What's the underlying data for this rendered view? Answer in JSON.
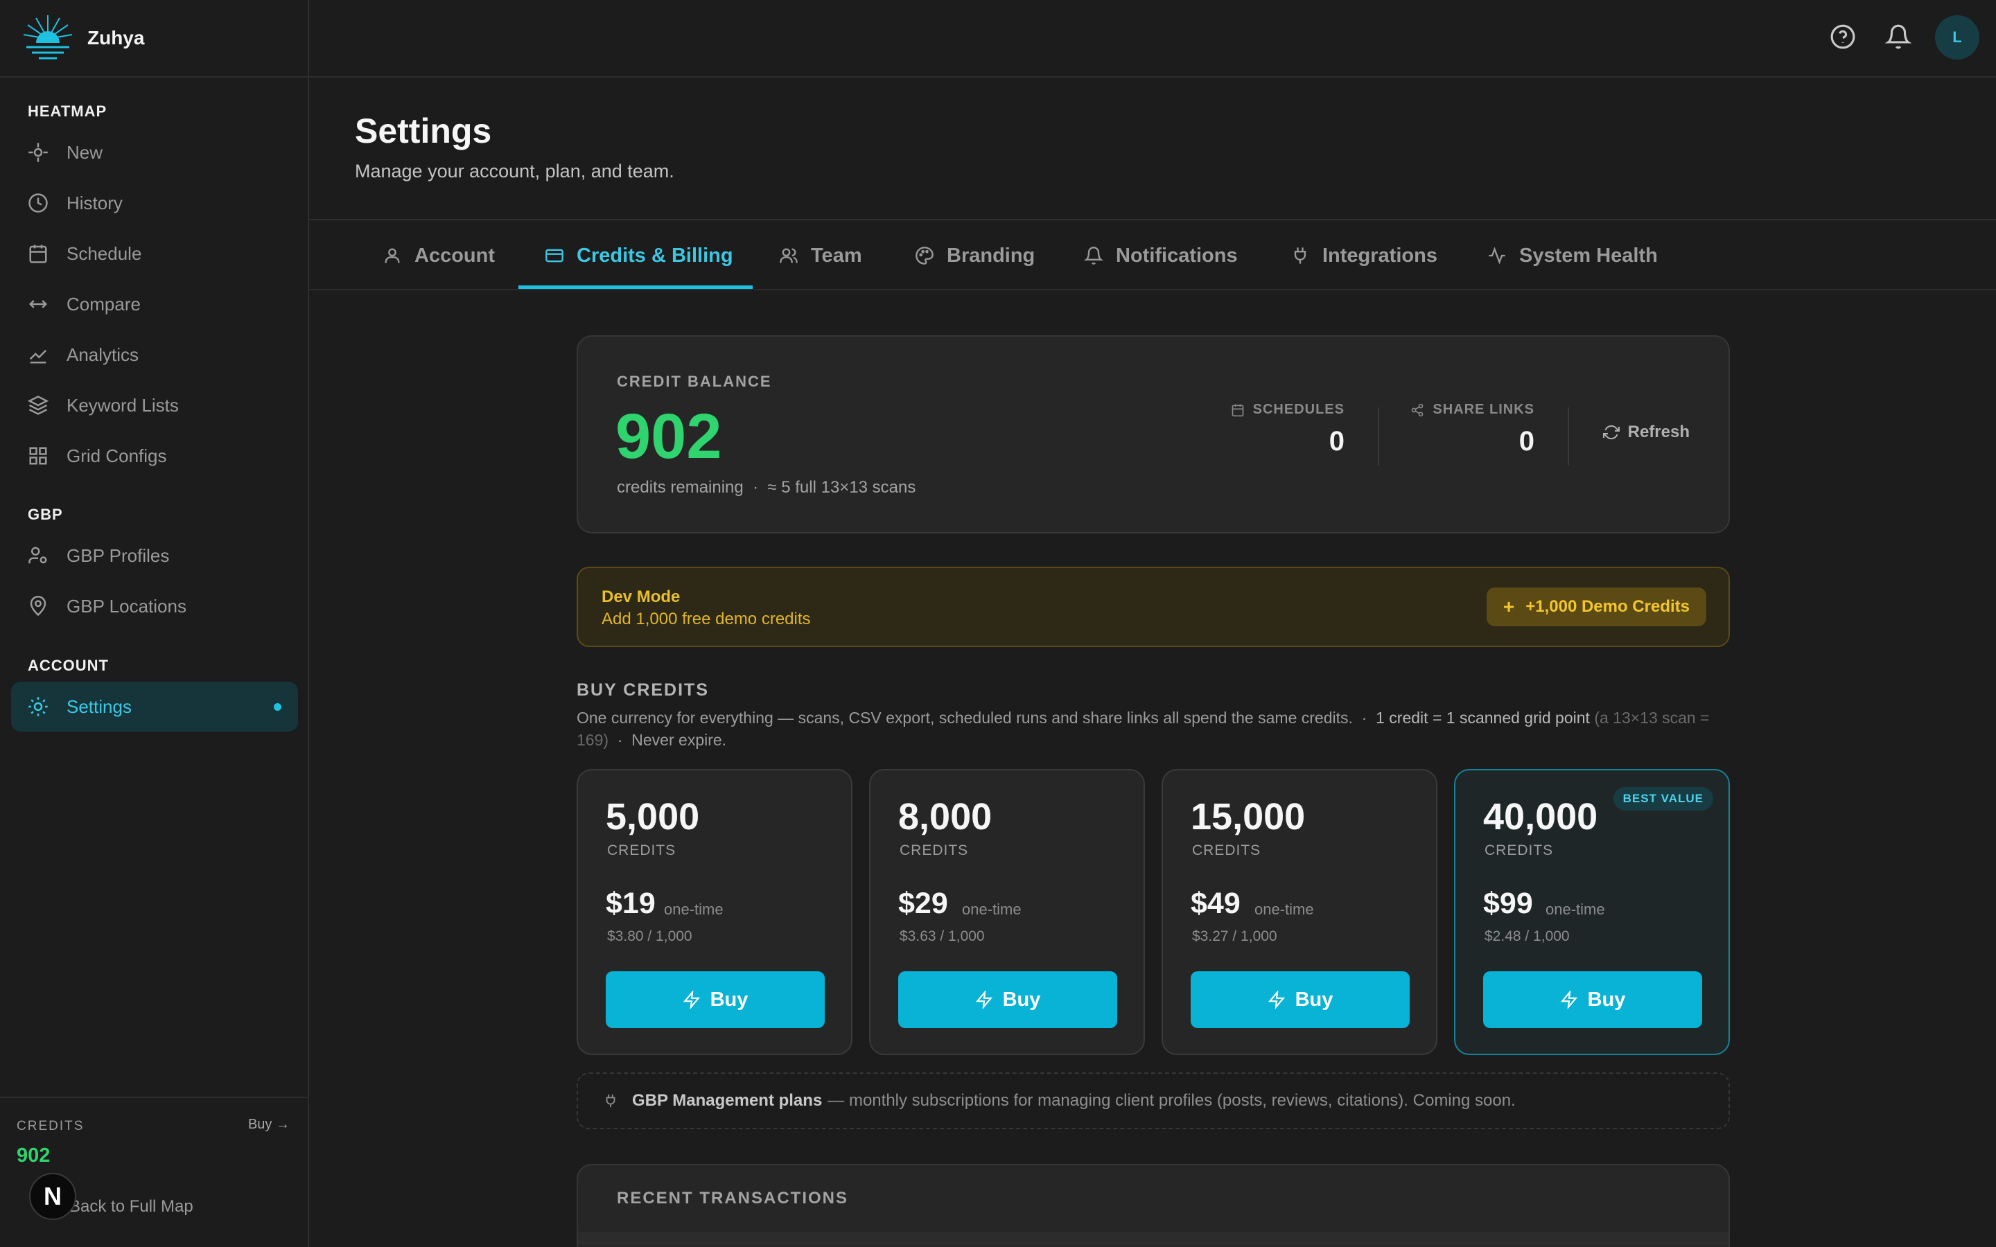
{
  "app": {
    "name": "Zuhya"
  },
  "sidebar": {
    "sections": [
      {
        "title": "HEATMAP",
        "items": [
          "New",
          "History",
          "Schedule",
          "Compare",
          "Analytics",
          "Keyword Lists",
          "Grid Configs"
        ]
      },
      {
        "title": "GBP",
        "items": [
          "GBP Profiles",
          "GBP Locations"
        ]
      },
      {
        "title": "ACCOUNT",
        "items": [
          "Settings"
        ]
      }
    ],
    "credits_label": "CREDITS",
    "credits_buy": "Buy →",
    "credits_value": "902",
    "back_link": "Back to Full Map",
    "next_badge": "N"
  },
  "header": {
    "avatar_initial": "L"
  },
  "page": {
    "title": "Settings",
    "subtitle": "Manage your account, plan, and team."
  },
  "tabs": [
    "Account",
    "Credits & Billing",
    "Team",
    "Branding",
    "Notifications",
    "Integrations",
    "System Health"
  ],
  "active_tab": "Credits & Billing",
  "balance": {
    "label": "CREDIT BALANCE",
    "value": "902",
    "sub": "credits remaining  ·  ≈ 5 full 13×13 scans",
    "schedules_label": "SCHEDULES",
    "schedules_value": "0",
    "share_label": "SHARE LINKS",
    "share_value": "0",
    "refresh": "Refresh"
  },
  "dev_mode": {
    "title": "Dev Mode",
    "subtitle": "Add 1,000 free demo credits",
    "button_plus": "+",
    "button": "+1,000 Demo Credits"
  },
  "buy": {
    "title": "BUY CREDITS",
    "desc_main": "One currency for everything — scans, CSV export, scheduled runs and share links all spend the same credits.",
    "desc_sep": "·",
    "desc_hl": "1 credit = 1 scanned grid point",
    "desc_muted": "(a 13×13 scan = 169)",
    "desc_end": "Never expire.",
    "plans": [
      {
        "amount": "5,000",
        "unit": "CREDITS",
        "price": "$19",
        "once": "one-time",
        "per": "$3.80 / 1,000",
        "button": "Buy"
      },
      {
        "amount": "8,000",
        "unit": "CREDITS",
        "price": "$29",
        "once": "one-time",
        "per": "$3.63 / 1,000",
        "button": "Buy"
      },
      {
        "amount": "15,000",
        "unit": "CREDITS",
        "price": "$49",
        "once": "one-time",
        "per": "$3.27 / 1,000",
        "button": "Buy"
      },
      {
        "amount": "40,000",
        "unit": "CREDITS",
        "price": "$99",
        "once": "one-time",
        "per": "$2.48 / 1,000",
        "button": "Buy",
        "badge": "BEST VALUE"
      }
    ]
  },
  "gbp_note": {
    "bold": "GBP Management plans",
    "rest": "— monthly subscriptions for managing client profiles (posts, reviews, citations). Coming soon."
  },
  "recent": {
    "title": "RECENT TRANSACTIONS"
  },
  "colors": {
    "accent": "#1ec1e0",
    "green": "#2fd46e",
    "gold": "#e9bf2a"
  }
}
